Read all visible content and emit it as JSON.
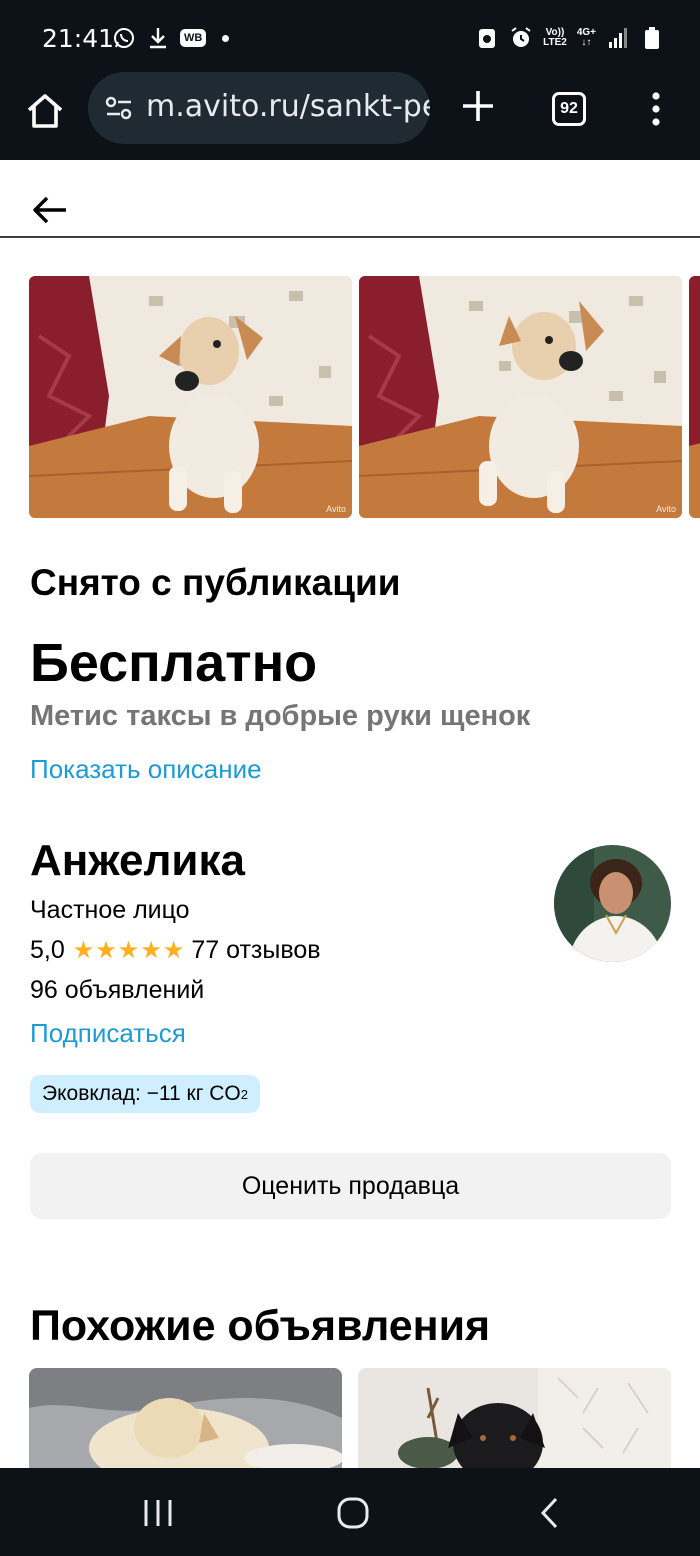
{
  "status_bar": {
    "time": "21:41",
    "wb_badge": "WB",
    "volte": "Vo))",
    "lte": "LTE2",
    "net": "4G+"
  },
  "browser": {
    "url": "m.avito.ru/sankt-pe",
    "tabs_count": "92"
  },
  "listing": {
    "status": "Снято с публикации",
    "price": "Бесплатно",
    "title": "Метис таксы в добрые руки щенок",
    "show_description": "Показать описание",
    "photo_watermark": "Avito"
  },
  "seller": {
    "name": "Анжелика",
    "type": "Частное лицо",
    "rating": "5,0",
    "stars": 5,
    "reviews": "77 отзывов",
    "ads": "96 объявлений",
    "subscribe": "Подписаться",
    "eco_label": "Эковклад: −11 кг CO",
    "eco_sub": "2",
    "rate_button": "Оценить продавца"
  },
  "similar": {
    "title": "Похожие объявления"
  },
  "colors": {
    "link": "#1e9ad6",
    "star": "#ffb021",
    "eco_bg": "#cfeeff",
    "system_bar": "#0d1218"
  }
}
